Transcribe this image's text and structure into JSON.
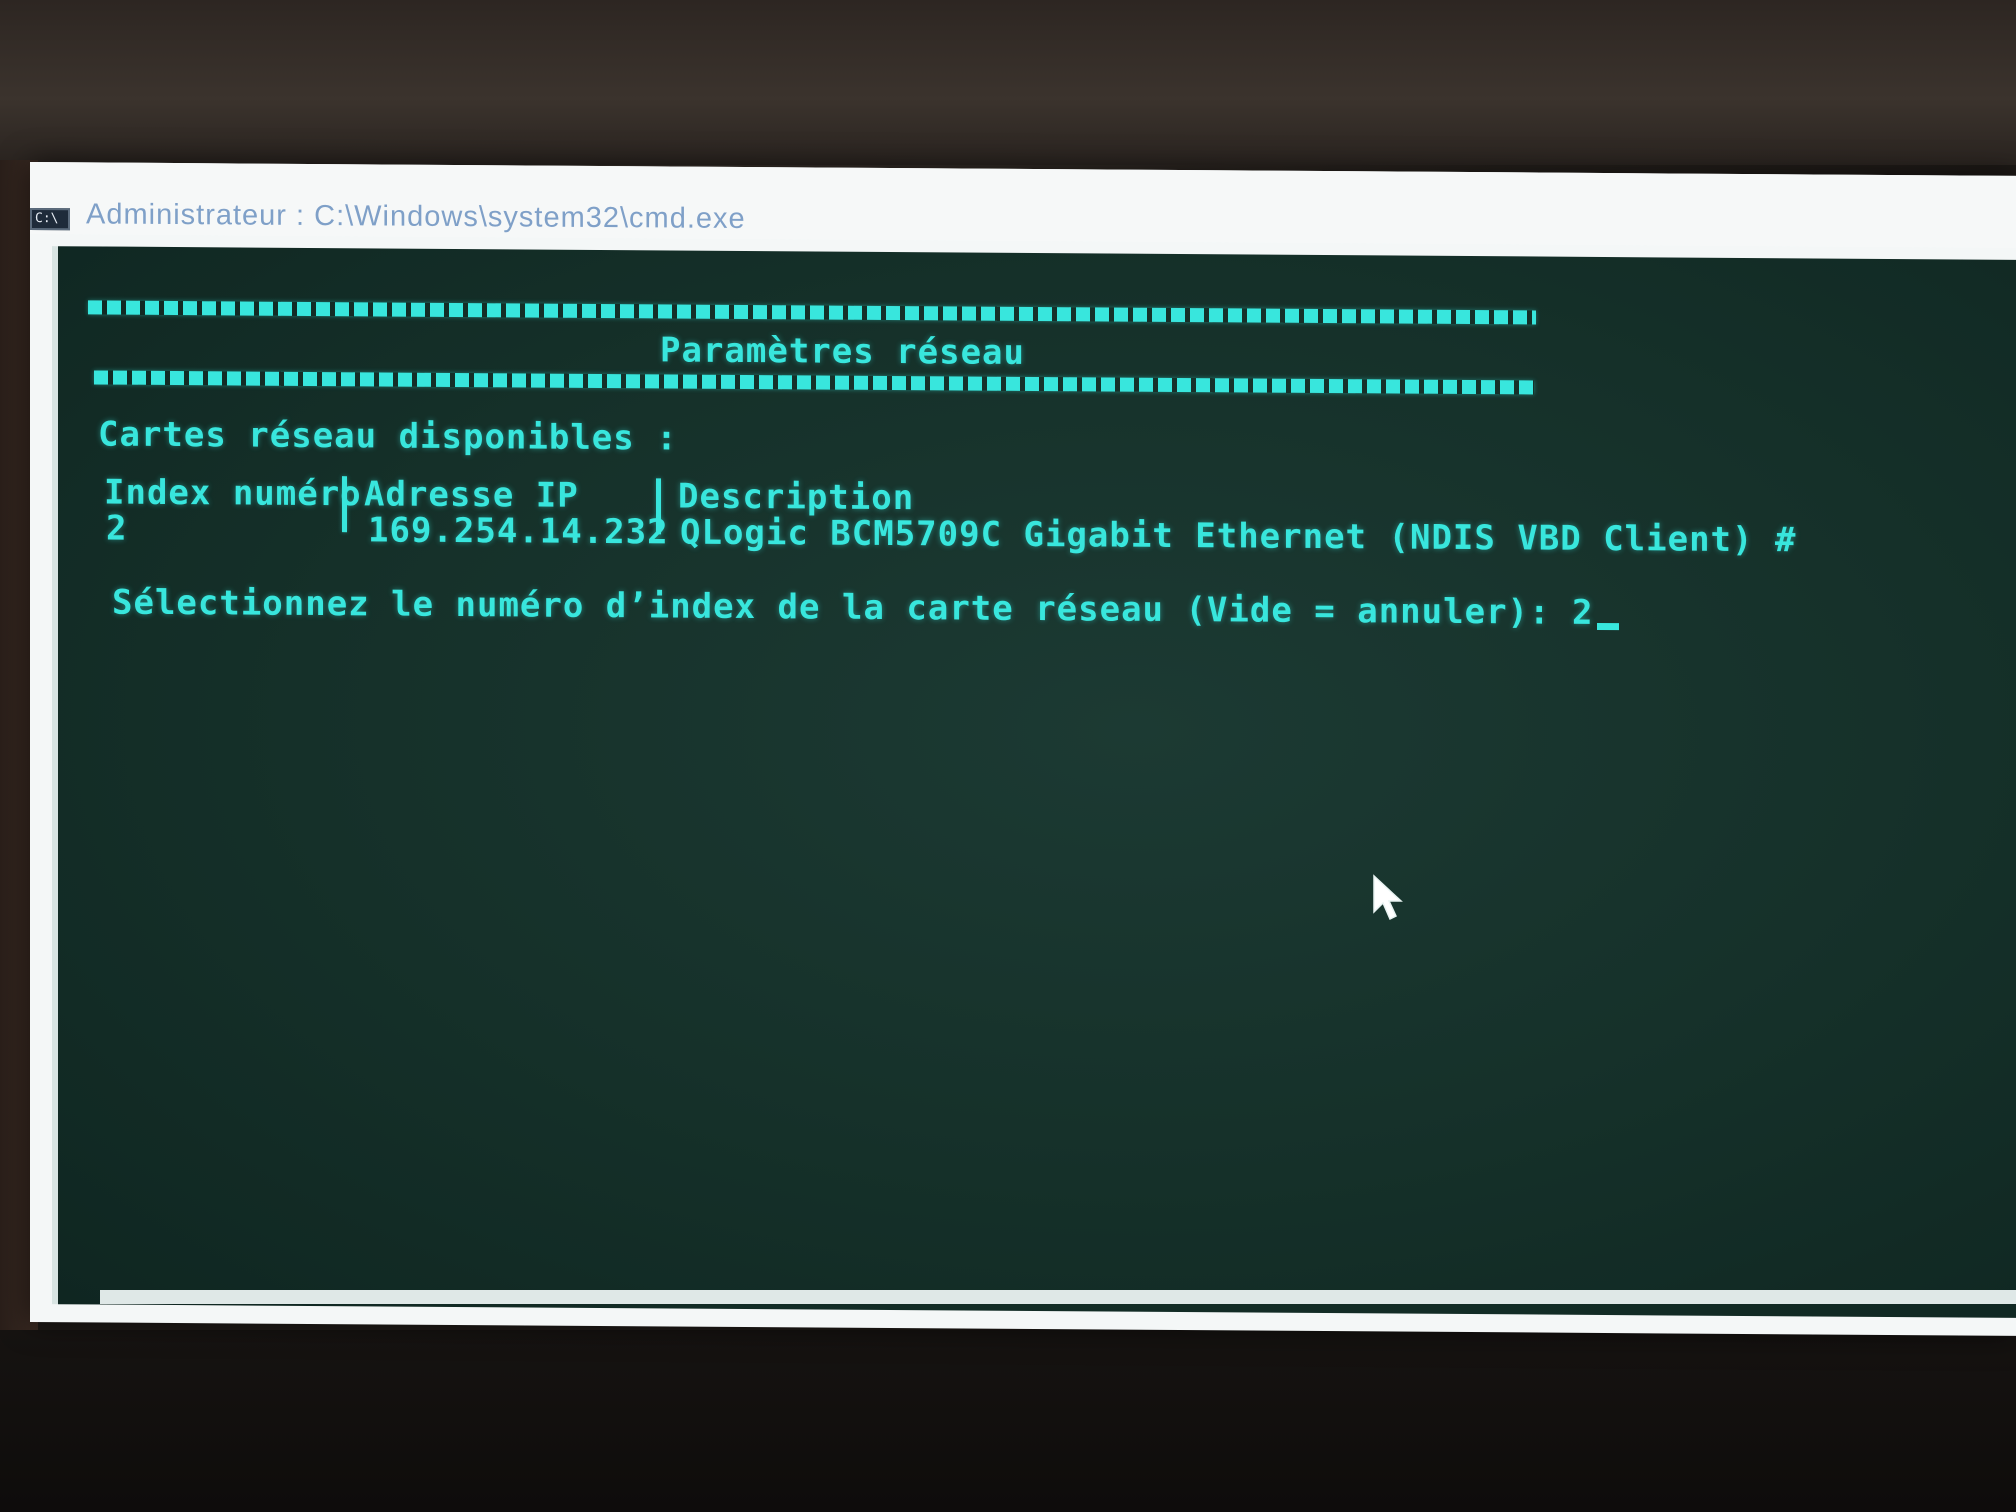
{
  "window": {
    "title": "Administrateur : C:\\Windows\\system32\\cmd.exe",
    "icon_label": "C:\\",
    "icon": "cmd-window-icon"
  },
  "console": {
    "heading": "Paramètres réseau",
    "adapters_label": "Cartes réseau disponibles :",
    "table": {
      "headers": [
        "Index numéro",
        "Adresse IP",
        "Description"
      ],
      "rows": [
        [
          "2",
          "169.254.14.232",
          "QLogic BCM5709C Gigabit Ethernet (NDIS VBD Client) #"
        ]
      ]
    },
    "prompt": "Sélectionnez le numéro d’index de la carte réseau (Vide = annuler): ",
    "input_value": "2"
  },
  "colors": {
    "console_text": "#38e6dd",
    "console_background": "#153029",
    "title_text": "#7fa0c8"
  },
  "pointer_icon": "mouse-pointer-icon"
}
